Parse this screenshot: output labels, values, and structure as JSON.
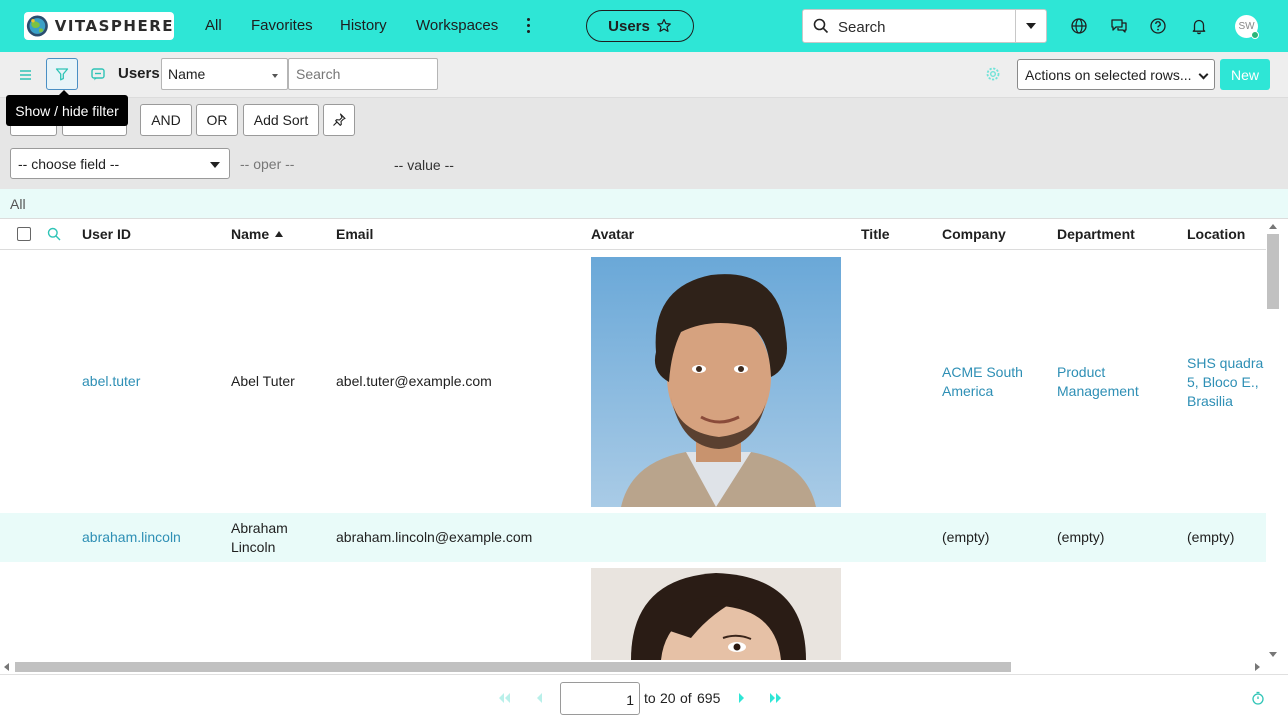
{
  "topnav": {
    "brand": "VITASPHERE",
    "links": [
      "All",
      "Favorites",
      "History",
      "Workspaces"
    ],
    "pill_label": "Users",
    "search_placeholder": "Search",
    "user_initials": "SW",
    "accent": "#2ee6d6"
  },
  "listbar": {
    "title": "Users",
    "field_select": "Name",
    "search_placeholder": "Search",
    "actions_select": "Actions on selected rows...",
    "new_label": "New"
  },
  "tooltip": "Show / hide filter",
  "filter": {
    "and_label": "AND",
    "or_label": "OR",
    "add_sort_label": "Add Sort",
    "choose_field": "-- choose field --",
    "oper": "-- oper --",
    "value": "-- value --"
  },
  "breadcrumb": "All",
  "table": {
    "columns": [
      "User ID",
      "Name",
      "Email",
      "Avatar",
      "Title",
      "Company",
      "Department",
      "Location"
    ],
    "rows": [
      {
        "user_id": "abel.tuter",
        "name": "Abel Tuter",
        "email": "abel.tuter@example.com",
        "title": "",
        "company": "ACME South America",
        "department": "Product Management",
        "location": "SHS quadra 5, Bloco E., Brasilia"
      },
      {
        "user_id": "abraham.lincoln",
        "name": "Abraham Lincoln",
        "email": "abraham.lincoln@example.com",
        "title": "",
        "company": "(empty)",
        "department": "(empty)",
        "location": "(empty)"
      }
    ]
  },
  "pager": {
    "current": "1",
    "to_label": "to",
    "to_value": "20",
    "of_label": "of",
    "total": "695"
  }
}
